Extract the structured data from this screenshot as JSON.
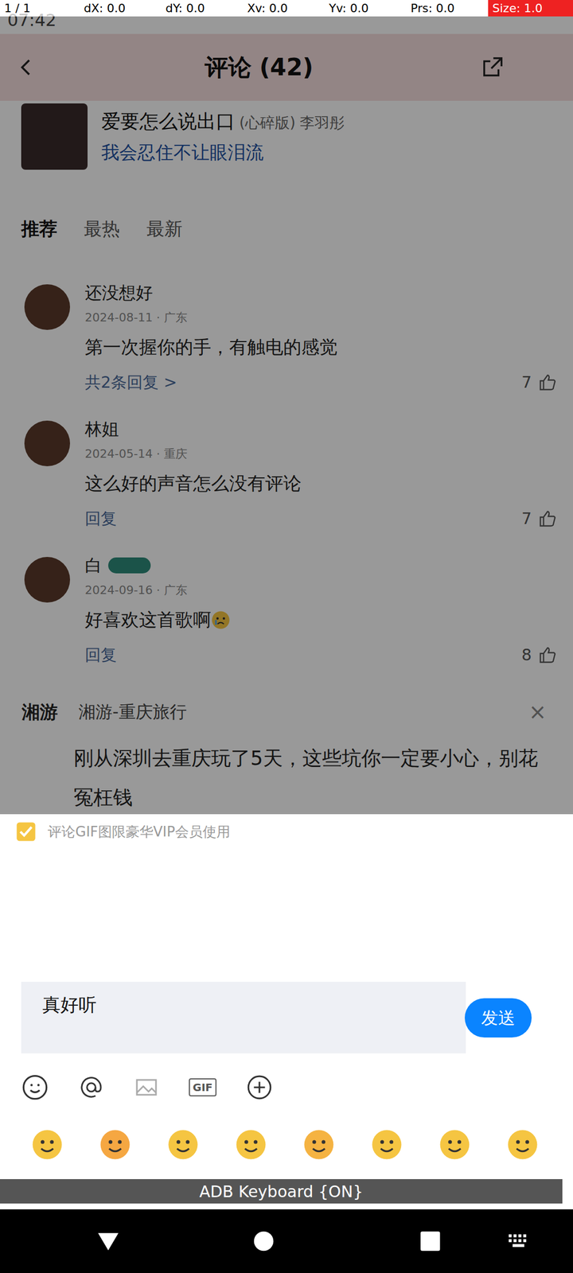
{
  "pointer_bar": {
    "fields": [
      "1 / 1",
      "dX: 0.0",
      "dY: 0.0",
      "Xv: 0.0",
      "Yv: 0.0",
      "Prs: 0.0",
      "Size: 1.0"
    ]
  },
  "status_bar": {
    "time": "07:42"
  },
  "header": {
    "title": "评论 (42)"
  },
  "song": {
    "title": "爱要怎么说出口",
    "version": "(心碎版)",
    "artist": "李羽彤",
    "lyric": "我会忍住不让眼泪流"
  },
  "tabs": [
    {
      "label": "推荐",
      "selected": true
    },
    {
      "label": "最热",
      "selected": false
    },
    {
      "label": "最新",
      "selected": false
    }
  ],
  "comments": [
    {
      "user": "还没想好",
      "badge": false,
      "meta": "2024-08-11 · 广东",
      "text": "第一次握你的手，有触电的感觉",
      "emoji": false,
      "reply": "共2条回复 >",
      "likes": "7"
    },
    {
      "user": "林姐",
      "badge": false,
      "meta": "2024-05-14 · 重庆",
      "text": "这么好的声音怎么没有评论",
      "emoji": false,
      "reply": "回复",
      "likes": "7"
    },
    {
      "user": "白",
      "badge": true,
      "meta": "2024-09-16 · 广东",
      "text": "好喜欢这首歌啊",
      "emoji": true,
      "reply": "回复",
      "likes": "8"
    }
  ],
  "ad": {
    "logo": "湘游",
    "title": "湘游-重庆旅行",
    "close": "×",
    "text": "刚从深圳去重庆玩了5天，这些坑你一定要小心，别花冤枉钱"
  },
  "panel": {
    "vip_note": "评论GIF图限豪华VIP会员使用",
    "input_value": "真好听",
    "send": "发送",
    "gif_icon_label": "GIF"
  },
  "keyboard_bar": {
    "label": "ADB Keyboard {ON}"
  }
}
